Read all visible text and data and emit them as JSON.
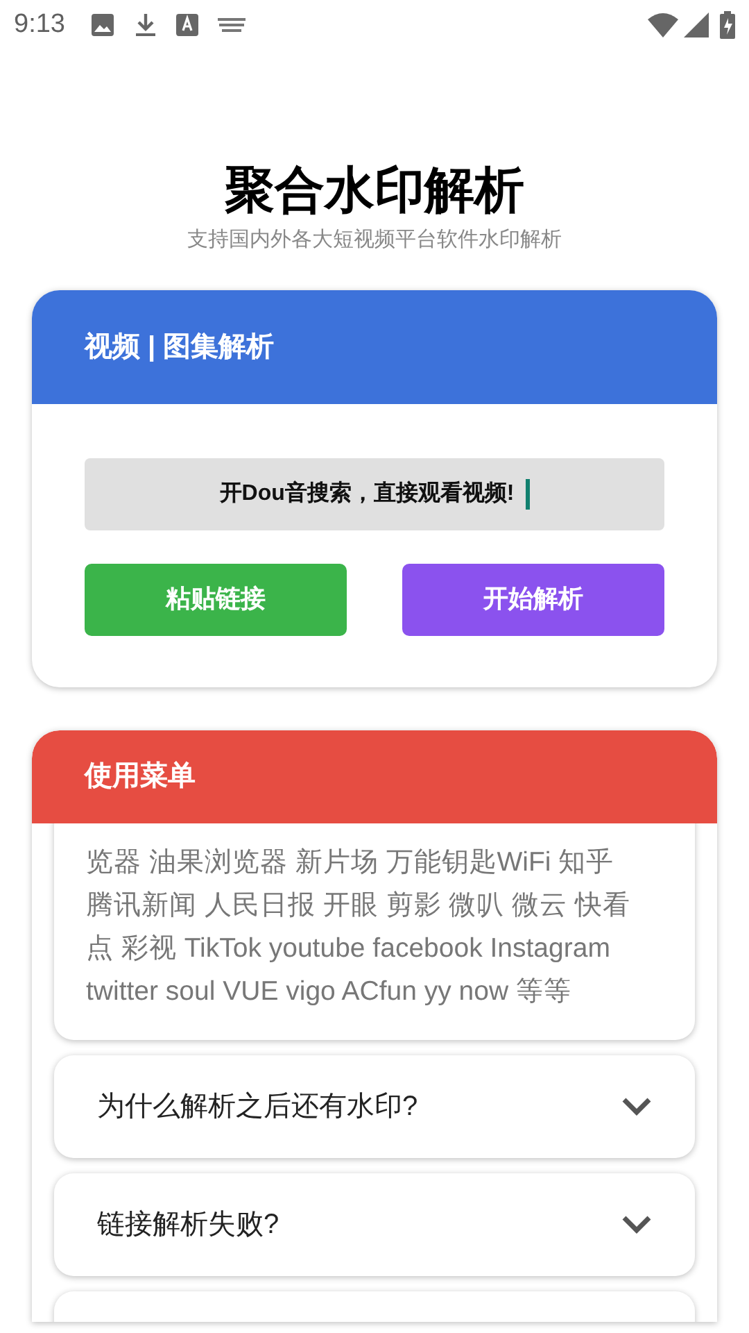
{
  "status_bar": {
    "time": "9:13"
  },
  "header": {
    "title": "聚合水印解析",
    "subtitle": "支持国内外各大短视频平台软件水印解析"
  },
  "parse_card": {
    "title": "视频 | 图集解析",
    "input": {
      "value": "开Dou音搜索，直接观看视频!",
      "focused": true
    },
    "buttons": [
      {
        "label": "粘贴链接",
        "color": "#3bb44a"
      },
      {
        "label": "开始解析",
        "color": "#8b52ee"
      }
    ]
  },
  "menu_card": {
    "title": "使用菜单",
    "platforms_lines": [
      "览器 油果浏览器 新片场 万能钥匙WiFi 知乎",
      "腾讯新闻 人民日报 开眼 剪影 微叭 微云 快看",
      "点 彩视 TikTok youtube facebook Instagram",
      "twitter soul VUE vigo ACfun yy now 等等"
    ],
    "faq": [
      {
        "question": "为什么解析之后还有水印?",
        "expanded": false
      },
      {
        "question": "链接解析失败?",
        "expanded": false
      }
    ]
  }
}
